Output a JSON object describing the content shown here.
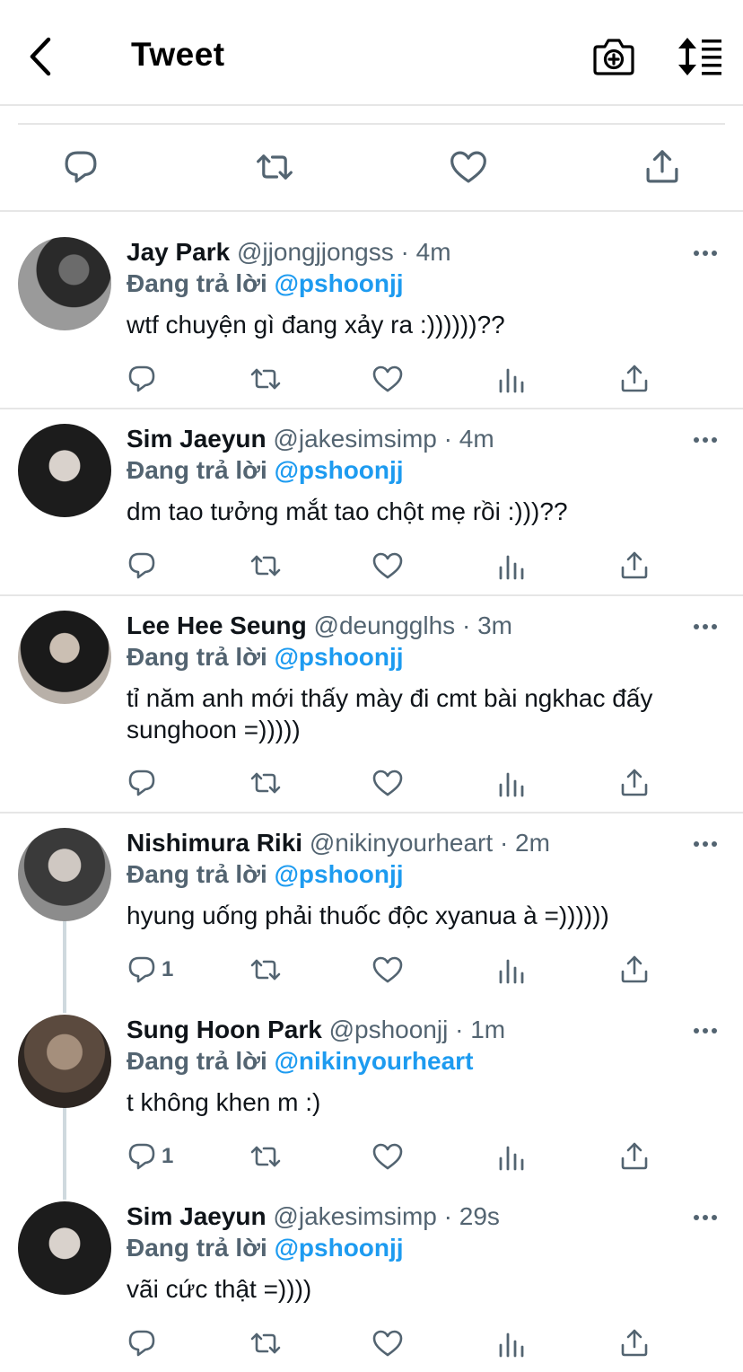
{
  "header": {
    "title": "Tweet",
    "icons": [
      "back-arrow-icon",
      "camera-plus-icon",
      "sort-icon"
    ]
  },
  "main_actions": [
    "reply-icon",
    "retweet-icon",
    "like-icon",
    "share-icon"
  ],
  "reply_prefix": "Đang trả lời",
  "tweets": [
    {
      "name": "Jay Park",
      "handle": "@jjongjjongss",
      "sep": "·",
      "time": "4m",
      "replying_to": "@pshoonjj",
      "text": "wtf chuyện gì đang xảy ra :))))))??",
      "reply_count": ""
    },
    {
      "name": "Sim Jaeyun",
      "handle": "@jakesimsimp",
      "sep": "·",
      "time": "4m",
      "replying_to": "@pshoonjj",
      "text": "dm tao tưởng mắt tao chột mẹ rồi :)))??",
      "reply_count": ""
    },
    {
      "name": "Lee Hee Seung",
      "handle": "@deungglhs",
      "sep": "·",
      "time": "3m",
      "replying_to": "@pshoonjj",
      "text": "tỉ năm anh mới thấy mày đi cmt bài ngkhac đấy sunghoon =)))))",
      "reply_count": ""
    },
    {
      "name": "Nishimura Riki",
      "handle": "@nikinyourheart",
      "sep": "·",
      "time": "2m",
      "replying_to": "@pshoonjj",
      "text": "hyung uống phải thuốc độc xyanua à =))))))",
      "reply_count": "1"
    },
    {
      "name": "Sung Hoon Park",
      "handle": "@pshoonjj",
      "sep": "·",
      "time": "1m",
      "replying_to": "@nikinyourheart",
      "text": "t không khen m :)",
      "reply_count": "1"
    },
    {
      "name": "Sim Jaeyun",
      "handle": "@jakesimsimp",
      "sep": "·",
      "time": "29s",
      "replying_to": "@pshoonjj",
      "text": "vãi cức thật =))))",
      "reply_count": ""
    }
  ],
  "colors": {
    "link": "#1d9bf0",
    "secondary": "#536471",
    "divider": "#e6e6e6",
    "thread_line": "#cfd9de"
  }
}
